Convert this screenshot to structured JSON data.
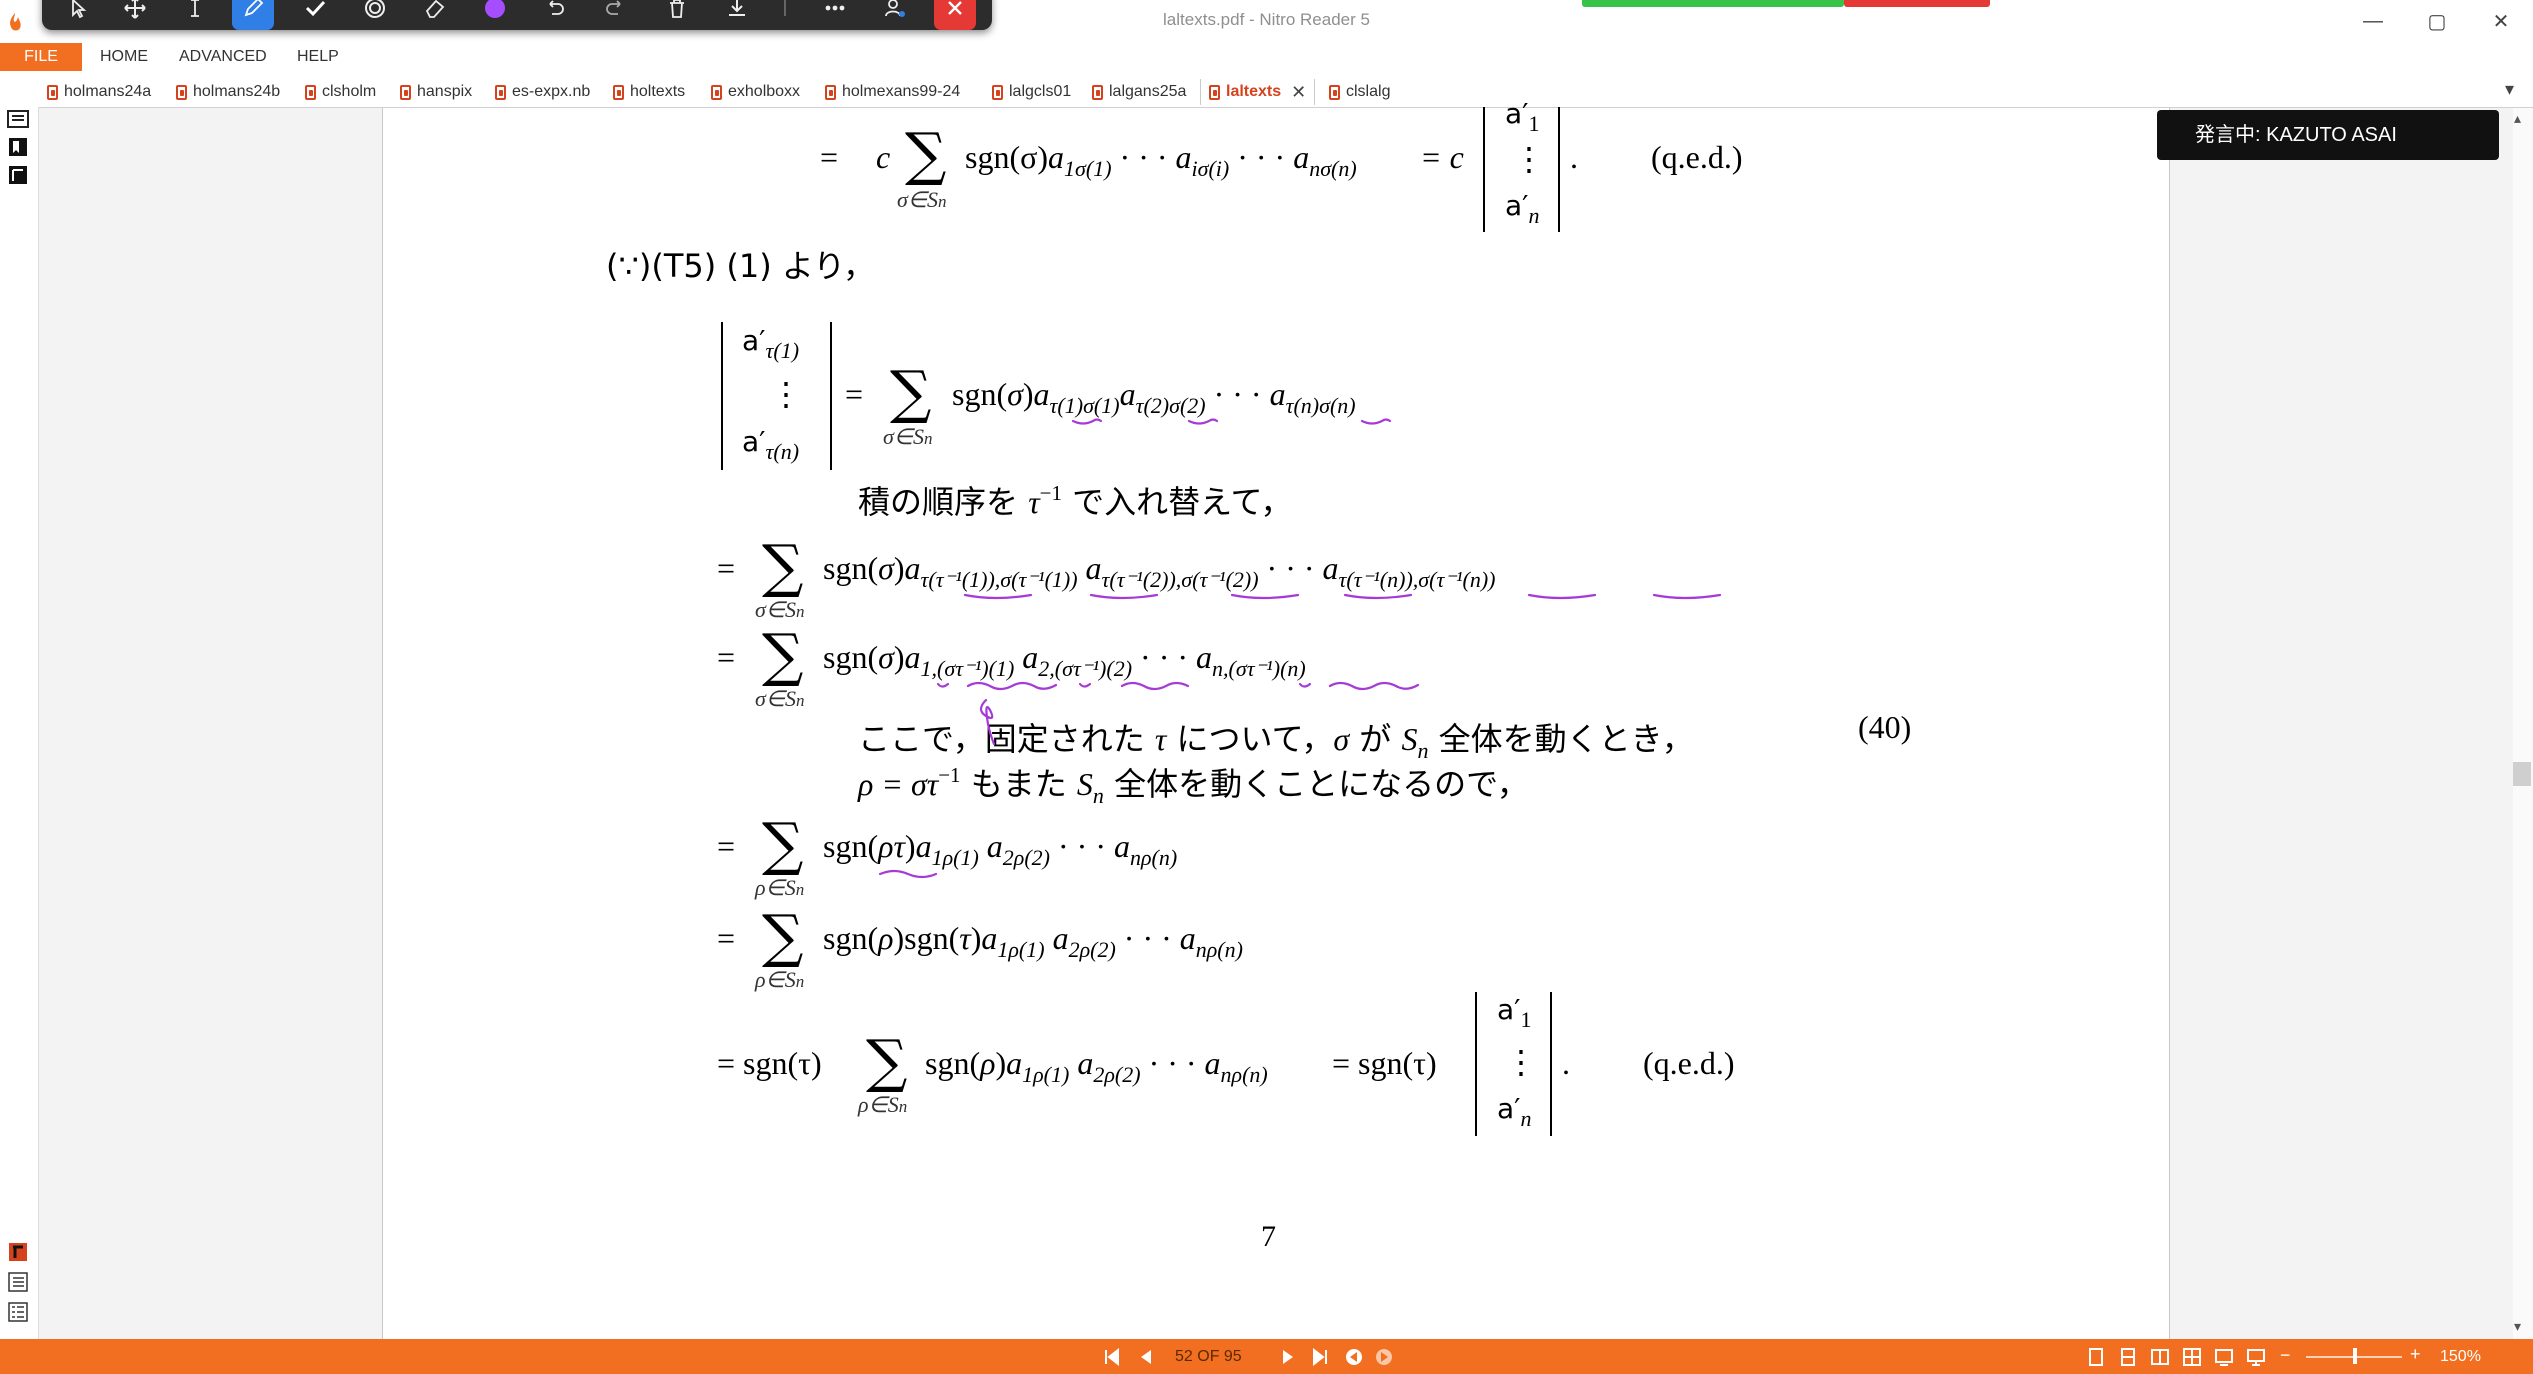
{
  "window": {
    "title": "laltexts.pdf - Nitro Reader 5"
  },
  "menu": {
    "file": "FILE",
    "home": "HOME",
    "advanced": "ADVANCED",
    "help": "HELP"
  },
  "tabs": [
    {
      "label": "holmans24a"
    },
    {
      "label": "holmans24b"
    },
    {
      "label": "clsholm"
    },
    {
      "label": "hanspix"
    },
    {
      "label": "es-expx.nb"
    },
    {
      "label": "holtexts"
    },
    {
      "label": "exholboxx"
    },
    {
      "label": "holmexans99-24"
    },
    {
      "label": "lalgcls01"
    },
    {
      "label": "lalgans25a"
    },
    {
      "label": "laltexts"
    },
    {
      "label": "clslalg"
    }
  ],
  "speaker": {
    "label": "発言中: KAZUTO ASAI"
  },
  "status": {
    "page_indicator": "52 OF 95",
    "zoom": "150%"
  },
  "colors": {
    "accent": "#f26f21",
    "annotation": "#a63ad6",
    "pen_tool": "#2f7fe6",
    "close": "#e53935"
  },
  "icons": [
    "select-arrow-icon",
    "move-icon",
    "text-cursor-icon",
    "pen-icon",
    "check-icon",
    "stamp-icon",
    "eraser-icon",
    "color-dot-icon",
    "undo-icon",
    "redo-icon",
    "trash-icon",
    "download-icon",
    "more-icon",
    "person-settings-icon",
    "close-icon"
  ],
  "document": {
    "l1_eq": "=",
    "l1_c": "c",
    "l1_sub": "σ∈S",
    "l1_subn": "n",
    "l1_sgn": "sgn(σ)",
    "l1_eq2": "= c",
    "l1_a1": "a′",
    "l1_a1s": "1",
    "l1_dots": "⋮",
    "l1_an": "a′",
    "l1_ans": "n",
    "l1_period": ".",
    "qed": "(q.e.d.)",
    "because": "(∵)(T5) (1) より，",
    "l2_atop": "a′",
    "l2_atops": "τ(1)",
    "l2_abot": "a′",
    "l2_abots": "τ(n)",
    "sum_sigma": "σ∈S",
    "sum_rho": "ρ∈S",
    "sub_n": "n",
    "note1_a": "積の順序を",
    "note1_b": "τ",
    "note1_c": "で入れ替えて，",
    "note2_a": "ここで，固定された",
    "note2_b": "τ",
    "note2_c": "について，",
    "note2_d": "σ",
    "note2_e": "が",
    "note2_f": "S",
    "note2_g": "全体を動くとき，",
    "note3_a": "ρ = στ",
    "note3_b": "もまた",
    "note3_c": "S",
    "note3_d": "全体を動くことになるので，",
    "eq_number": "(40)",
    "l_last_sgn_tau": "= sgn(τ)",
    "l_last_eq": "= sgn(τ)",
    "l_last_a1": "a′",
    "l_last_a1s": "1",
    "l_last_an": "a′",
    "l_last_ans": "n",
    "page_number": "7"
  }
}
